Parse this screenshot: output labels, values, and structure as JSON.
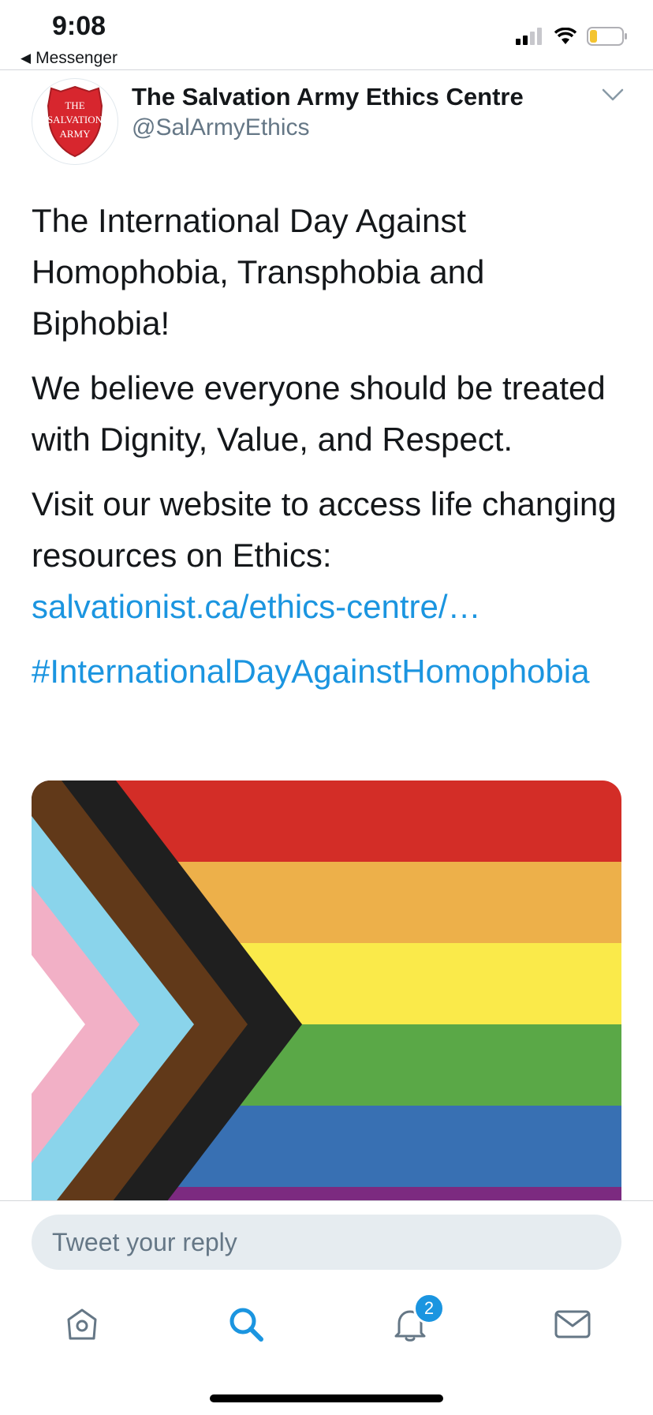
{
  "status_bar": {
    "time": "9:08",
    "back_app": "Messenger",
    "icons": [
      "signal-icon",
      "wifi-icon",
      "battery-icon"
    ]
  },
  "tweet": {
    "display_name": "The Salvation Army Ethics Centre",
    "handle": "@SalArmyEthics",
    "avatar_logo_text": "THE SALVATION ARMY",
    "paragraphs": [
      "The International Day Against Homophobia, Transphobia and Biphobia!",
      "We believe everyone should be treated with Dignity, Value, and Respect.",
      "Visit our website to access life changing resources on Ethics:"
    ],
    "link": "salvationist.ca/ethics-centre/…",
    "hashtag": "#InternationalDayAgainstHomophobia",
    "media": {
      "description_icon": "progress-pride-flag-image",
      "stripe_colors": [
        "#d32d27",
        "#edb04a",
        "#faea4a",
        "#5aa847",
        "#3870b3",
        "#7c2a80"
      ],
      "chevron_colors": [
        "#000000",
        "#f2b0c6",
        "#8ad4eb",
        "#613919",
        "#1f1f1f"
      ]
    }
  },
  "reply": {
    "placeholder": "Tweet your reply"
  },
  "tab_bar": {
    "notifications_badge": "2",
    "tabs": [
      "home-icon",
      "search-icon",
      "notifications-icon",
      "messages-icon"
    ]
  },
  "colors": {
    "accent": "#1b95e0",
    "text_primary": "#14171a",
    "text_secondary": "#657786"
  }
}
